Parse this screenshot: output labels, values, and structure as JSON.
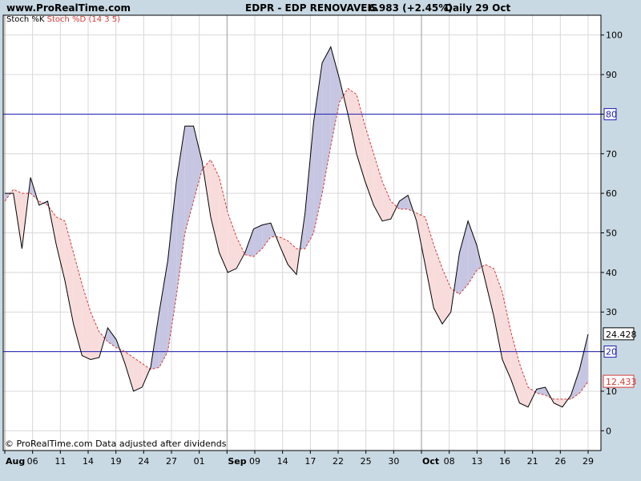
{
  "header": {
    "site": "www.ProRealTime.com",
    "symbol": "EDPR - EDP RENOVAVEIS",
    "price": "6.983 (+2.45%)",
    "period": "Daily  29 Oct"
  },
  "indicator": {
    "k_label": "Stoch %K",
    "d_label": "Stoch %D (14 3 5)"
  },
  "footer": "© ProRealTime.com  Data adjusted after dividends",
  "colors": {
    "background": "#ffffff",
    "frame": "#c9d9e3",
    "k_line": "#000000",
    "d_line": "#d73a3a",
    "fill_k_above": "#c6c6e2",
    "fill_d_above": "#f8dcdc",
    "level_line": "#1e1eb4",
    "grid": "#d8d8d8"
  },
  "chart_data": {
    "type": "line",
    "ylim": [
      -5,
      105
    ],
    "yticks": [
      "0",
      "10",
      "20",
      "30",
      "40",
      "50",
      "60",
      "70",
      "80",
      "90",
      "100"
    ],
    "levels": [
      80,
      20
    ],
    "level_labels": [
      "80",
      "20"
    ],
    "x_ticks": [
      "Aug",
      "06",
      "11",
      "14",
      "19",
      "24",
      "27",
      "01",
      "Sep",
      "09",
      "14",
      "17",
      "22",
      "25",
      "30",
      "Oct",
      "08",
      "13",
      "16",
      "21",
      "26",
      "29"
    ],
    "bold_x_ticks": [
      "Aug",
      "Sep",
      "Oct"
    ],
    "month_starts": [
      "Aug",
      "Sep",
      "Oct"
    ],
    "last_k_label": "24.428",
    "last_d_label": "12.433",
    "series": [
      {
        "values": [
          60,
          60,
          46,
          64,
          57,
          58,
          47,
          38,
          27,
          19,
          18,
          18.5,
          26,
          23,
          17,
          10,
          11,
          16,
          30,
          43,
          63,
          77,
          77,
          68,
          54,
          45,
          40,
          41,
          45,
          51,
          52,
          52.5,
          47,
          42,
          39.5,
          55,
          78,
          93,
          97,
          89,
          80,
          70,
          63,
          57,
          53,
          53.5,
          58,
          59.5,
          53,
          42,
          31,
          27,
          30,
          45,
          53,
          47,
          38,
          29,
          18,
          13,
          7,
          6,
          10.5,
          11,
          7,
          6,
          9,
          15.5,
          24.4
        ]
      },
      {
        "values": [
          58,
          61,
          60,
          60,
          58,
          57,
          54,
          53,
          45,
          37,
          30,
          25,
          22.5,
          21,
          20,
          18.5,
          17,
          15.5,
          16,
          20,
          34,
          50,
          58,
          66,
          68.5,
          64,
          55,
          49,
          44.5,
          44,
          46,
          49,
          49,
          48,
          46,
          46,
          50,
          60,
          72,
          83,
          86.5,
          85,
          77,
          70,
          63,
          58,
          56,
          56,
          55,
          54,
          47,
          41,
          36,
          34.5,
          37,
          40.5,
          42,
          41,
          35,
          25,
          17,
          11,
          9.5,
          9,
          8,
          8,
          8,
          9.5,
          12.4
        ]
      }
    ]
  }
}
